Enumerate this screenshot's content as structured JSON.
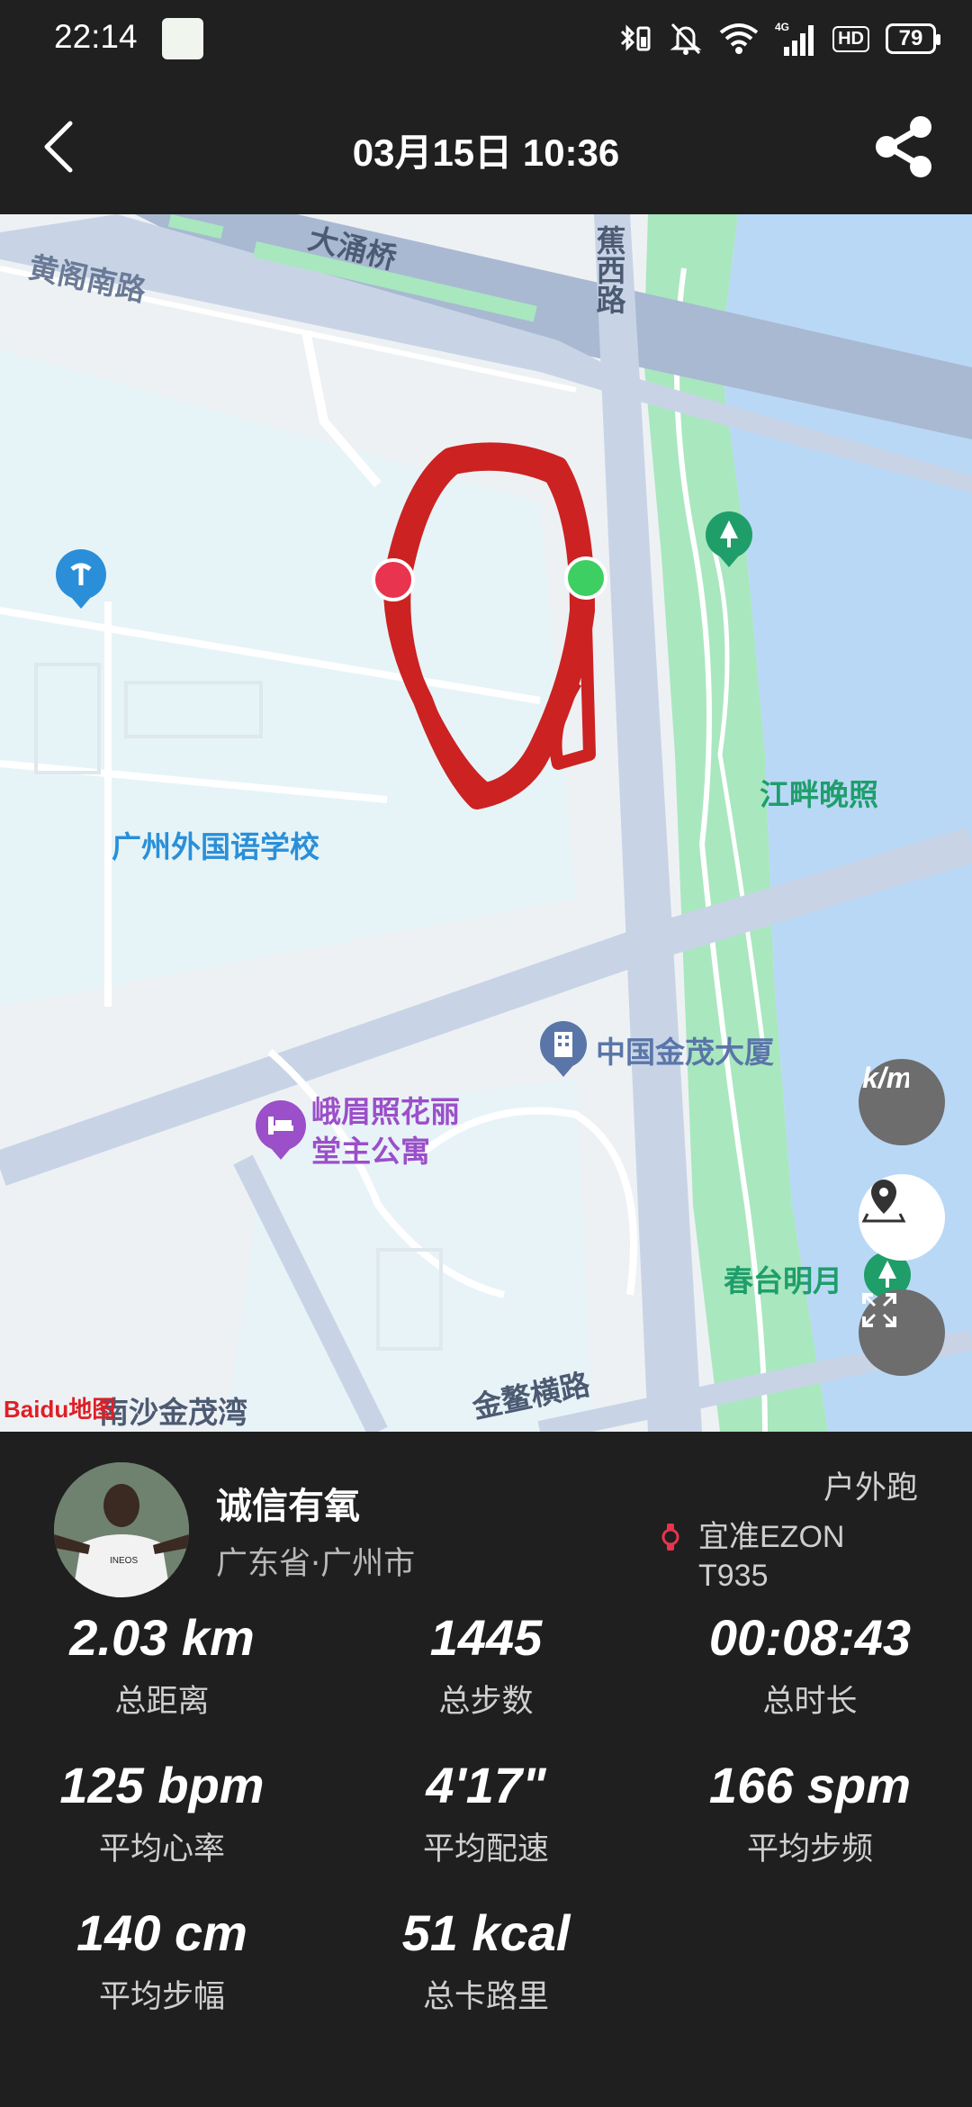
{
  "status_bar": {
    "time": "22:14",
    "battery": "79",
    "hd": "HD",
    "network": "4G"
  },
  "header": {
    "title": "03月15日 10:36"
  },
  "map": {
    "road_labels": [
      "黄阁南路",
      "大涌桥",
      "蕉西路",
      "南沙金茂湾",
      "金鳌横路"
    ],
    "pois": [
      {
        "name": "广州外国语学校",
        "color": "#2a8fd8",
        "icon": "school-icon"
      },
      {
        "name": "江畔晚照",
        "color": "#1f9e6a",
        "icon": "park-icon"
      },
      {
        "name": "中国金茂大厦",
        "color": "#5a76a8",
        "icon": "building-icon"
      },
      {
        "name": "峨眉照花丽",
        "name2": "堂主公寓",
        "color": "#9b4fc9",
        "icon": "hotel-icon"
      },
      {
        "name": "春台明月",
        "color": "#1f9e6a",
        "icon": "park-icon"
      }
    ],
    "baidu_logo": "Baidu地图",
    "colors": {
      "track": "#cc2222",
      "start": "#3dcf62",
      "end": "#e8344e",
      "water": "#b9d8f6",
      "green": "#a9e7bf"
    }
  },
  "profile": {
    "username": "诚信有氧",
    "location": "广东省·广州市",
    "activity_type": "户外跑",
    "device_line1": "宜准EZON",
    "device_line2": "T935"
  },
  "stats": [
    {
      "value": "2.03 km",
      "label": "总距离"
    },
    {
      "value": "1445",
      "label": "总步数"
    },
    {
      "value": "00:08:43",
      "label": "总时长"
    },
    {
      "value": "125 bpm",
      "label": "平均心率"
    },
    {
      "value": "4'17\"",
      "label": "平均配速"
    },
    {
      "value": "166 spm",
      "label": "平均步频"
    },
    {
      "value": "140 cm",
      "label": "平均步幅"
    },
    {
      "value": "51 kcal",
      "label": "总卡路里"
    }
  ]
}
